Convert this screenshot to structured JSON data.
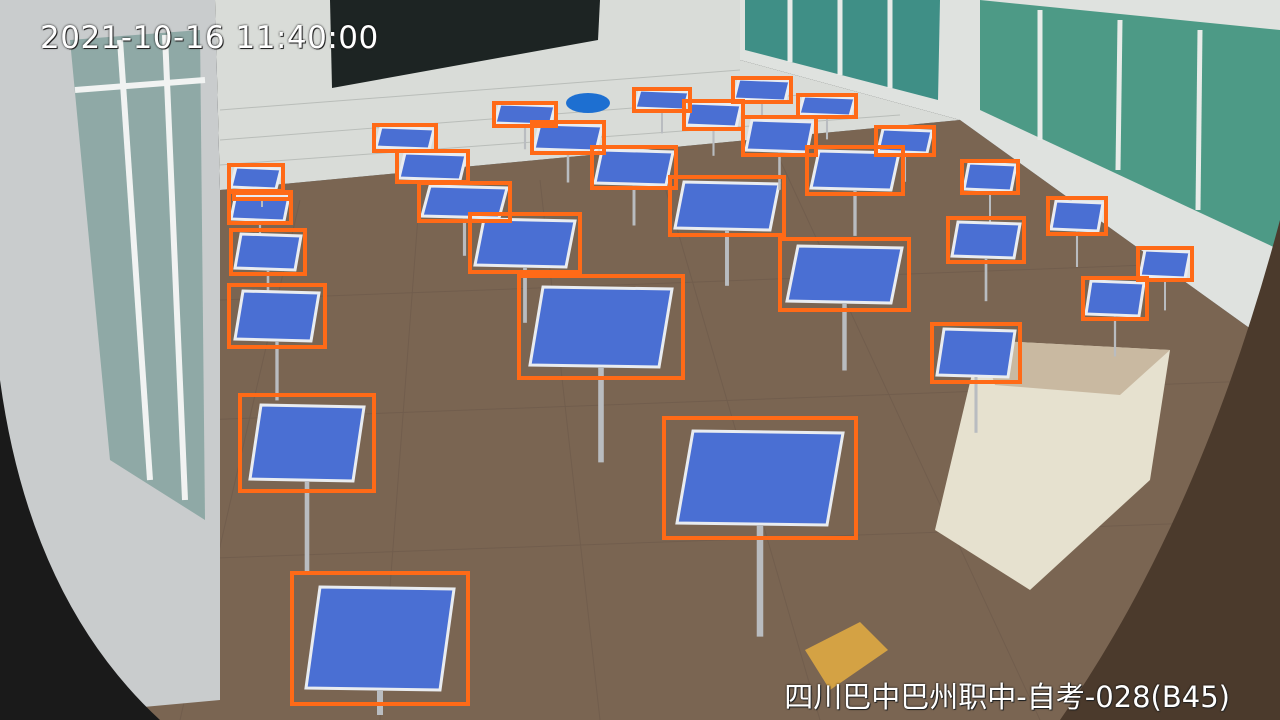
{
  "overlay": {
    "timestamp": "2021-10-16 11:40:00",
    "camera_label": "四川巴中巴州职中-自考-028(B45)"
  },
  "scene": {
    "subject": "classroom with rows of blue-topped student desks and chairs",
    "detection_box_color": "#ff6a17",
    "detection_label": "desk",
    "detection_count": 31
  }
}
